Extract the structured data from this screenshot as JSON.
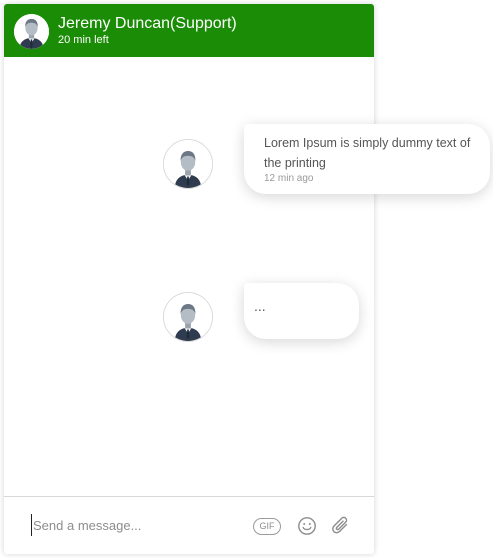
{
  "header": {
    "name": "Jeremy Duncan(Support)",
    "status": "20 min left",
    "background": "#1a8c06"
  },
  "messages": [
    {
      "text": "Lorem Ipsum is simply dummy text of the printing",
      "time": "12 min ago"
    },
    {
      "typing": "..."
    }
  ],
  "composer": {
    "placeholder": "Send a message...",
    "gif_label": "GIF",
    "emoji_icon": "smiley-icon",
    "attach_icon": "paperclip-icon"
  }
}
